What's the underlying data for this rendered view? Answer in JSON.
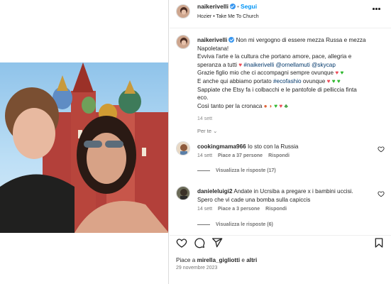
{
  "post": {
    "username": "naikerivelli",
    "follow_label": "Segui",
    "audio": "Hozier",
    "audio_track": "Take Me To Church",
    "audio_sep": "•"
  },
  "caption": {
    "username": "naikerivelli",
    "lines": [
      "Non mi vergogno di essere mezza Russa e mezza",
      "Napoletana!",
      "Evviva l'arte e la cultura che portano amore, pace, allegria e",
      "speranza a tutti",
      "Grazie figlio mio che ci accompagni sempre ovunque",
      "E anche qui abbiamo portato",
      "Sappiate che Etsy fa i colbacchi e le pantofole di pelliccia finta",
      "eco.",
      "Così tanto per la cronaca"
    ],
    "tags_line4": "#naikerivelli @ornellamuti @skycap",
    "tag_line6": "#ecofashio",
    "line6_suffix": "ovunque",
    "time": "14 sett"
  },
  "see_translation": "Per te",
  "comments": [
    {
      "username": "cookingmama966",
      "text": "Io sto con la Russia",
      "time": "14 sett",
      "likes": "Piace a 37 persone",
      "reply": "Rispondi",
      "view_replies": "Visualizza le risposte (17)"
    },
    {
      "username": "danieleluigi2",
      "text_line1": "Andate in Ucrsiba a pregare x i bambini uccisi.",
      "text_line2": "Spero che vi cade una bomba sulla capiccis",
      "time": "14 sett",
      "likes": "Piace a 3 persone",
      "reply": "Rispondi",
      "view_replies": "Visualizza le risposte (6)"
    }
  ],
  "footer": {
    "likes_prefix": "Piace a",
    "liked_by": "mirella_gigliotti",
    "likes_and": "e",
    "likes_others": "altri",
    "date": "29 novembre 2023"
  },
  "colors": {
    "accent": "#0095f6",
    "verified": "#3897f0",
    "heart": "#ed4956"
  }
}
